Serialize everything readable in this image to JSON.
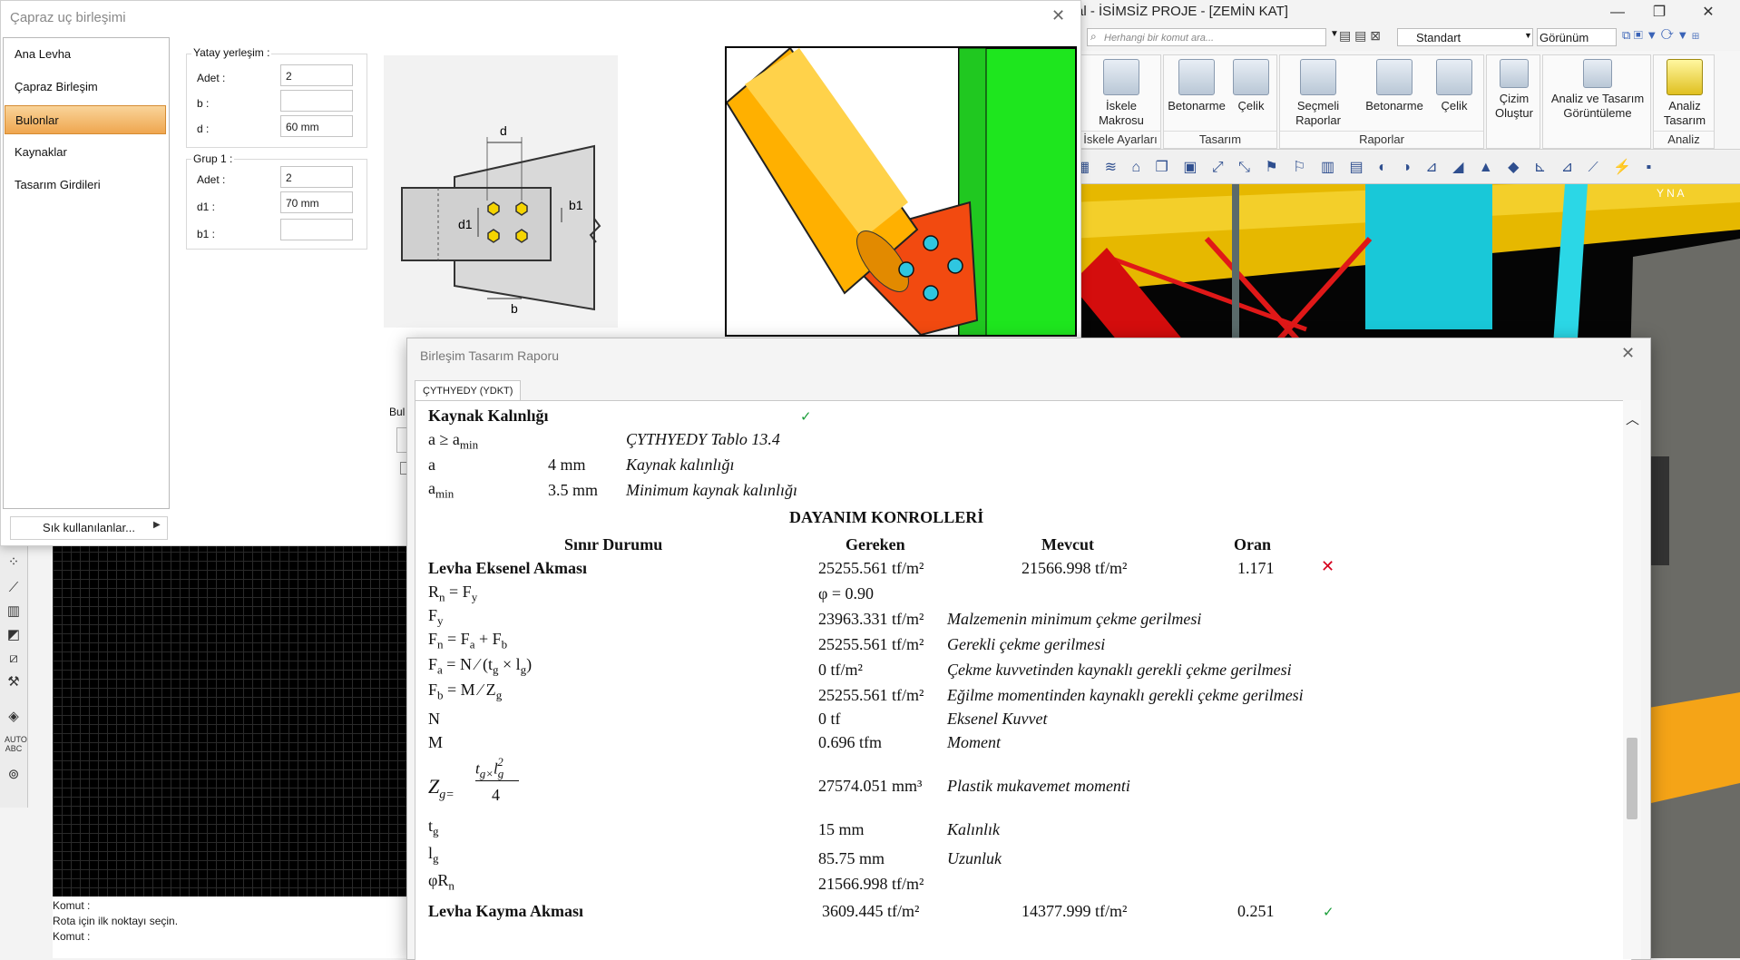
{
  "app": {
    "title": "al - İSİMSİZ PROJE - [ZEMİN KAT]",
    "search_placeholder": "Herhangi bir komut ara...",
    "standard_select": "Standart",
    "view_select": "Görünüm",
    "ribbon_groups": [
      {
        "label": "İskele Ayarları",
        "buttons": [
          "İskele\nMakrosu"
        ]
      },
      {
        "label": "Tasarım",
        "buttons": [
          "Betonarme",
          "Çelik"
        ]
      },
      {
        "label": "Raporlar",
        "buttons": [
          "Seçmeli\nRaporlar",
          "Betonarme",
          "Çelik"
        ]
      },
      {
        "label": "",
        "buttons": [
          "Çizim\nOluştur"
        ]
      },
      {
        "label": "",
        "buttons": [
          "Analiz ve Tasarım\nGörüntüleme"
        ]
      },
      {
        "label": "Analiz",
        "buttons": [
          "Analiz\nTasarım"
        ]
      }
    ],
    "command_lines": [
      "Komut :",
      "Rota için ilk noktayı seçin.",
      "Komut :"
    ]
  },
  "dialog1": {
    "title": "Çapraz uç birleşimi",
    "nav": [
      "Ana Levha",
      "Çapraz Birleşim",
      "Bulonlar",
      "Kaynaklar",
      "Tasarım Girdileri"
    ],
    "active_nav": "Bulonlar",
    "favorites": "Sık kullanılanlar...",
    "group_horizontal": {
      "title": "Yatay yerleşim :",
      "adet_label": "Adet :",
      "adet": "2",
      "b_label": "b :",
      "b": "",
      "d_label": "d :",
      "d": "60 mm"
    },
    "group1": {
      "title": "Grup 1 :",
      "adet_label": "Adet :",
      "adet": "2",
      "d1_label": "d1 :",
      "d1": "70 mm",
      "b1_label": "b1 :",
      "b1": ""
    },
    "partial_label": "Bul",
    "schematic_labels": {
      "d": "d",
      "d1": "d1",
      "b1": "b1",
      "b": "b"
    }
  },
  "dialog2": {
    "title": "Birleşim Tasarım Raporu",
    "tab": "ÇYTHYEDY (YDKT)",
    "weld_section": "Kaynak Kalınlığı",
    "weld_rows": [
      {
        "a": "a ≥ a",
        "a_sub": "min",
        "b": "",
        "c": "ÇYTHYEDY Tablo 13.4"
      },
      {
        "a": "a",
        "a_sub": "",
        "b": "4 mm",
        "c": "Kaynak kalınlığı"
      },
      {
        "a": "a",
        "a_sub": "min",
        "b": "3.5 mm",
        "c": "Minimum kaynak kalınlığı"
      }
    ],
    "strength_header": "DAYANIM KONROLLERİ",
    "columns": [
      "Sınır Durumu",
      "Gereken",
      "Mevcut",
      "Oran"
    ],
    "check1": {
      "name": "Levha Eksenel Akması",
      "required": "25255.561 tf/m²",
      "available": "21566.998 tf/m²",
      "ratio": "1.171",
      "status": "fail"
    },
    "phi": "φ = 0.90",
    "rows": [
      {
        "value": "23963.331 tf/m²",
        "desc": "Malzemenin minimum çekme gerilmesi"
      },
      {
        "value": "25255.561 tf/m²",
        "desc": "Gerekli çekme gerilmesi"
      },
      {
        "value": "0 tf/m²",
        "desc": "Çekme kuvvetinden kaynaklı gerekli çekme gerilmesi"
      },
      {
        "value": "25255.561 tf/m²",
        "desc": "Eğilme momentinden kaynaklı gerekli çekme gerilmesi"
      },
      {
        "value": "0 tf",
        "desc": "Eksenel Kuvvet"
      },
      {
        "value": "0.696 tfm",
        "desc": "Moment"
      },
      {
        "value": "27574.051 mm³",
        "desc": "Plastik mukavemet momenti"
      },
      {
        "value": "15 mm",
        "desc": "Kalınlık"
      },
      {
        "value": "85.75 mm",
        "desc": "Uzunluk"
      },
      {
        "value": "21566.998 tf/m²",
        "desc": ""
      }
    ],
    "check2": {
      "name": "Levha Kayma Akması",
      "required": "3609.445 tf/m²",
      "available": "14377.999 tf/m²",
      "ratio": "0.251",
      "status": "ok"
    }
  }
}
